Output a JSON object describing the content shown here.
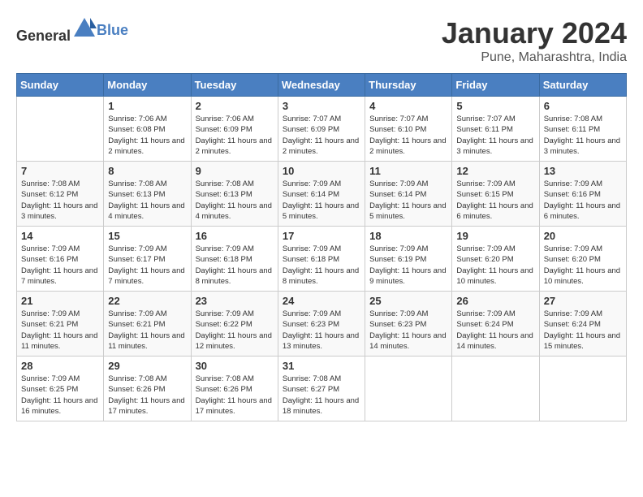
{
  "header": {
    "logo_general": "General",
    "logo_blue": "Blue",
    "title": "January 2024",
    "location": "Pune, Maharashtra, India"
  },
  "days_of_week": [
    "Sunday",
    "Monday",
    "Tuesday",
    "Wednesday",
    "Thursday",
    "Friday",
    "Saturday"
  ],
  "weeks": [
    [
      {
        "day": "",
        "sunrise": "",
        "sunset": "",
        "daylight": ""
      },
      {
        "day": "1",
        "sunrise": "Sunrise: 7:06 AM",
        "sunset": "Sunset: 6:08 PM",
        "daylight": "Daylight: 11 hours and 2 minutes."
      },
      {
        "day": "2",
        "sunrise": "Sunrise: 7:06 AM",
        "sunset": "Sunset: 6:09 PM",
        "daylight": "Daylight: 11 hours and 2 minutes."
      },
      {
        "day": "3",
        "sunrise": "Sunrise: 7:07 AM",
        "sunset": "Sunset: 6:09 PM",
        "daylight": "Daylight: 11 hours and 2 minutes."
      },
      {
        "day": "4",
        "sunrise": "Sunrise: 7:07 AM",
        "sunset": "Sunset: 6:10 PM",
        "daylight": "Daylight: 11 hours and 2 minutes."
      },
      {
        "day": "5",
        "sunrise": "Sunrise: 7:07 AM",
        "sunset": "Sunset: 6:11 PM",
        "daylight": "Daylight: 11 hours and 3 minutes."
      },
      {
        "day": "6",
        "sunrise": "Sunrise: 7:08 AM",
        "sunset": "Sunset: 6:11 PM",
        "daylight": "Daylight: 11 hours and 3 minutes."
      }
    ],
    [
      {
        "day": "7",
        "sunrise": "Sunrise: 7:08 AM",
        "sunset": "Sunset: 6:12 PM",
        "daylight": "Daylight: 11 hours and 3 minutes."
      },
      {
        "day": "8",
        "sunrise": "Sunrise: 7:08 AM",
        "sunset": "Sunset: 6:13 PM",
        "daylight": "Daylight: 11 hours and 4 minutes."
      },
      {
        "day": "9",
        "sunrise": "Sunrise: 7:08 AM",
        "sunset": "Sunset: 6:13 PM",
        "daylight": "Daylight: 11 hours and 4 minutes."
      },
      {
        "day": "10",
        "sunrise": "Sunrise: 7:09 AM",
        "sunset": "Sunset: 6:14 PM",
        "daylight": "Daylight: 11 hours and 5 minutes."
      },
      {
        "day": "11",
        "sunrise": "Sunrise: 7:09 AM",
        "sunset": "Sunset: 6:14 PM",
        "daylight": "Daylight: 11 hours and 5 minutes."
      },
      {
        "day": "12",
        "sunrise": "Sunrise: 7:09 AM",
        "sunset": "Sunset: 6:15 PM",
        "daylight": "Daylight: 11 hours and 6 minutes."
      },
      {
        "day": "13",
        "sunrise": "Sunrise: 7:09 AM",
        "sunset": "Sunset: 6:16 PM",
        "daylight": "Daylight: 11 hours and 6 minutes."
      }
    ],
    [
      {
        "day": "14",
        "sunrise": "Sunrise: 7:09 AM",
        "sunset": "Sunset: 6:16 PM",
        "daylight": "Daylight: 11 hours and 7 minutes."
      },
      {
        "day": "15",
        "sunrise": "Sunrise: 7:09 AM",
        "sunset": "Sunset: 6:17 PM",
        "daylight": "Daylight: 11 hours and 7 minutes."
      },
      {
        "day": "16",
        "sunrise": "Sunrise: 7:09 AM",
        "sunset": "Sunset: 6:18 PM",
        "daylight": "Daylight: 11 hours and 8 minutes."
      },
      {
        "day": "17",
        "sunrise": "Sunrise: 7:09 AM",
        "sunset": "Sunset: 6:18 PM",
        "daylight": "Daylight: 11 hours and 8 minutes."
      },
      {
        "day": "18",
        "sunrise": "Sunrise: 7:09 AM",
        "sunset": "Sunset: 6:19 PM",
        "daylight": "Daylight: 11 hours and 9 minutes."
      },
      {
        "day": "19",
        "sunrise": "Sunrise: 7:09 AM",
        "sunset": "Sunset: 6:20 PM",
        "daylight": "Daylight: 11 hours and 10 minutes."
      },
      {
        "day": "20",
        "sunrise": "Sunrise: 7:09 AM",
        "sunset": "Sunset: 6:20 PM",
        "daylight": "Daylight: 11 hours and 10 minutes."
      }
    ],
    [
      {
        "day": "21",
        "sunrise": "Sunrise: 7:09 AM",
        "sunset": "Sunset: 6:21 PM",
        "daylight": "Daylight: 11 hours and 11 minutes."
      },
      {
        "day": "22",
        "sunrise": "Sunrise: 7:09 AM",
        "sunset": "Sunset: 6:21 PM",
        "daylight": "Daylight: 11 hours and 11 minutes."
      },
      {
        "day": "23",
        "sunrise": "Sunrise: 7:09 AM",
        "sunset": "Sunset: 6:22 PM",
        "daylight": "Daylight: 11 hours and 12 minutes."
      },
      {
        "day": "24",
        "sunrise": "Sunrise: 7:09 AM",
        "sunset": "Sunset: 6:23 PM",
        "daylight": "Daylight: 11 hours and 13 minutes."
      },
      {
        "day": "25",
        "sunrise": "Sunrise: 7:09 AM",
        "sunset": "Sunset: 6:23 PM",
        "daylight": "Daylight: 11 hours and 14 minutes."
      },
      {
        "day": "26",
        "sunrise": "Sunrise: 7:09 AM",
        "sunset": "Sunset: 6:24 PM",
        "daylight": "Daylight: 11 hours and 14 minutes."
      },
      {
        "day": "27",
        "sunrise": "Sunrise: 7:09 AM",
        "sunset": "Sunset: 6:24 PM",
        "daylight": "Daylight: 11 hours and 15 minutes."
      }
    ],
    [
      {
        "day": "28",
        "sunrise": "Sunrise: 7:09 AM",
        "sunset": "Sunset: 6:25 PM",
        "daylight": "Daylight: 11 hours and 16 minutes."
      },
      {
        "day": "29",
        "sunrise": "Sunrise: 7:08 AM",
        "sunset": "Sunset: 6:26 PM",
        "daylight": "Daylight: 11 hours and 17 minutes."
      },
      {
        "day": "30",
        "sunrise": "Sunrise: 7:08 AM",
        "sunset": "Sunset: 6:26 PM",
        "daylight": "Daylight: 11 hours and 17 minutes."
      },
      {
        "day": "31",
        "sunrise": "Sunrise: 7:08 AM",
        "sunset": "Sunset: 6:27 PM",
        "daylight": "Daylight: 11 hours and 18 minutes."
      },
      {
        "day": "",
        "sunrise": "",
        "sunset": "",
        "daylight": ""
      },
      {
        "day": "",
        "sunrise": "",
        "sunset": "",
        "daylight": ""
      },
      {
        "day": "",
        "sunrise": "",
        "sunset": "",
        "daylight": ""
      }
    ]
  ]
}
